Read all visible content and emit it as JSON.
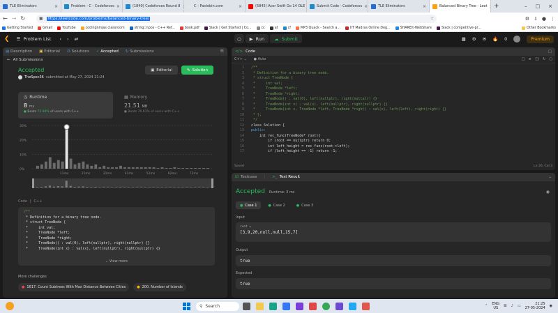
{
  "browser": {
    "tabs": [
      {
        "label": "TLE Eliminators",
        "color": "#2b6bd6",
        "active": false
      },
      {
        "label": "Problem - C - Codeforces",
        "color": "#1f8acb",
        "active": false
      },
      {
        "label": "(1840) Codeforces Round 8",
        "color": "#1f8acb",
        "active": false
      },
      {
        "label": "C - Pastebin.com",
        "color": "#e5e5e5",
        "active": false
      },
      {
        "label": "(5845) Acer Swift Go 14 OLE",
        "color": "#ff0000",
        "active": false
      },
      {
        "label": "Submit Code - Codeforces",
        "color": "#1f8acb",
        "active": false
      },
      {
        "label": "TLE Eliminators",
        "color": "#2b6bd6",
        "active": false
      },
      {
        "label": "Balanced Binary Tree - Leet",
        "color": "#ffa116",
        "active": true
      }
    ],
    "url_prefix": "",
    "url": "https://leetcode.com/problems/balanced-binary-tree/",
    "bookmarks": [
      "Getting Started",
      "Gmail",
      "YouTube",
      "codingninjas classroom",
      "string::npos - C++ Ref...",
      "book.pdf",
      "Slack | Get Started | Co...",
      "cc",
      "at",
      "cf",
      "MP3 Quack - Search a...",
      "IIT Madras Online Deg...",
      "SHAREit-WebShare",
      "Slack | competitive-pr..."
    ],
    "other_bookmarks": "Other Bookmarks"
  },
  "nav": {
    "problem_list": "Problem List",
    "run": "Run",
    "submit": "Submit",
    "streak": "0",
    "premium": "Premium"
  },
  "left": {
    "tabs": [
      "Description",
      "Editorial",
      "Solutions",
      "Accepted",
      "Submissions"
    ],
    "all_submissions": "All Submissions",
    "status": "Accepted",
    "user": "TheSpec36",
    "submitted": "submitted at May 27, 2024 21:24",
    "editorial_btn": "Editorial",
    "solution_btn": "Solution",
    "runtime_label": "Runtime",
    "runtime_value": "8",
    "runtime_unit": "ms",
    "runtime_beats": "Beats",
    "runtime_pct": "72.94%",
    "runtime_suffix": "of users with C++",
    "memory_label": "Memory",
    "memory_value": "21.51",
    "memory_unit": "MB",
    "memory_beats": "Beats",
    "memory_pct": "76.61%",
    "memory_suffix": "of users with C++",
    "code_label": "Code",
    "code_lang": "C++",
    "code_lines": [
      "/**",
      " * Definition for a binary tree node.",
      " * struct TreeNode {",
      " *     int val;",
      " *     TreeNode *left;",
      " *     TreeNode *right;",
      " *     TreeNode() : val(0), left(nullptr), right(nullptr) {}",
      " *     TreeNode(int x) : val(x), left(nullptr), right(nullptr) {}"
    ],
    "view_more": "View more",
    "more_challenges": "More challenges",
    "challenges": [
      "1617. Count Subtrees With Max Distance Between Cities",
      "200. Number of Islands"
    ]
  },
  "chart_data": {
    "type": "bar",
    "yticks": [
      "30%",
      "20%",
      "10%",
      "0%"
    ],
    "xticks": [
      "11ms",
      "21ms",
      "31ms",
      "41ms",
      "52ms",
      "62ms",
      "72ms"
    ],
    "ylim": [
      0,
      30
    ],
    "values": [
      2,
      3,
      5,
      8,
      4,
      6,
      5,
      29,
      7,
      3,
      4,
      5,
      3,
      2,
      3,
      1,
      2,
      1,
      1,
      1,
      2,
      1,
      1,
      1,
      1,
      1,
      1,
      1,
      1,
      0.5,
      1,
      0.5,
      0.5,
      1,
      0.5,
      0.5,
      0.5,
      0.5,
      0.5,
      0.5,
      0.5,
      0.5
    ],
    "highlight_index": 7
  },
  "editor": {
    "title": "Code",
    "lang": "C++",
    "auto": "Auto",
    "saved": "Saved",
    "cursor": "Ln 26, Col 3",
    "lines": [
      {
        "n": "1",
        "t": "/**",
        "c": "cm"
      },
      {
        "n": "2",
        "t": " * Definition for a binary tree node.",
        "c": "cm"
      },
      {
        "n": "3",
        "t": " * struct TreeNode {",
        "c": "cm"
      },
      {
        "n": "4",
        "t": " *     int val;",
        "c": "cm"
      },
      {
        "n": "5",
        "t": " *     TreeNode *left;",
        "c": "cm"
      },
      {
        "n": "6",
        "t": " *     TreeNode *right;",
        "c": "cm"
      },
      {
        "n": "7",
        "t": " *     TreeNode() : val(0), left(nullptr), right(nullptr) {}",
        "c": "cm"
      },
      {
        "n": "8",
        "t": " *     TreeNode(int x) : val(x), left(nullptr), right(nullptr) {}",
        "c": "cm"
      },
      {
        "n": "9",
        "t": " *     TreeNode(int x, TreeNode *left, TreeNode *right) : val(x), left(left), right(right) {}",
        "c": "cm"
      },
      {
        "n": "10",
        "t": " * };",
        "c": "cm"
      },
      {
        "n": "11",
        "t": " */",
        "c": "cm"
      },
      {
        "n": "12",
        "t": "class Solution {",
        "c": ""
      },
      {
        "n": "13",
        "t": "public:",
        "c": "kw"
      },
      {
        "n": "14",
        "t": "    int rec_func(TreeNode* root){",
        "c": ""
      },
      {
        "n": "15",
        "t": "        if (root == nullptr) return 0;",
        "c": ""
      },
      {
        "n": "16",
        "t": "        int left_height = rec_func(root->left);",
        "c": ""
      },
      {
        "n": "17",
        "t": "        if (left_height == -1) return -1;",
        "c": ""
      }
    ]
  },
  "testpanel": {
    "tab1": "Testcase",
    "tab2": "Test Result",
    "status": "Accepted",
    "runtime": "Runtime: 3 ms",
    "cases": [
      "Case 1",
      "Case 2",
      "Case 3"
    ],
    "input_label": "Input",
    "var": "root =",
    "input_value": "[3,9,20,null,null,15,7]",
    "output_label": "Output",
    "output_value": "true",
    "expected_label": "Expected",
    "expected_value": "true"
  },
  "taskbar": {
    "search": "Search",
    "lang": "ENG",
    "region": "US",
    "time": "21:25",
    "date": "27-05-2024"
  },
  "colors": {
    "green": "#2cbb5d",
    "orange": "#ffa116",
    "panel": "#262626",
    "bg": "#1a1a1a"
  }
}
